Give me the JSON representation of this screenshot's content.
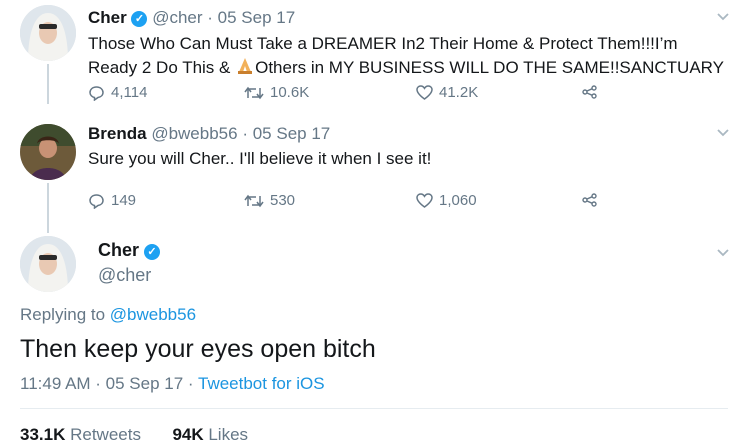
{
  "tweet1": {
    "name": "Cher",
    "handle": "@cher",
    "separator": "·",
    "date": "05 Sep 17",
    "line1": "Those Who Can Must Take a DREAMER In2 Their Home & Protect Them!!!I’m",
    "line2_a": "Ready 2 Do This & ",
    "line2_b": "Others in MY BUSINESS WILL DO THE SAME!!SANCTUARY",
    "replies": "4,114",
    "retweets": "10.6K",
    "likes": "41.2K"
  },
  "tweet2": {
    "name": "Brenda",
    "handle": "@bwebb56",
    "separator": "·",
    "date": "05 Sep 17",
    "text": "Sure you will Cher.. I'll believe it when I see it!",
    "replies": "149",
    "retweets": "530",
    "likes": "1,060"
  },
  "main_tweet": {
    "name": "Cher",
    "handle": "@cher",
    "replying_prefix": "Replying to ",
    "replying_to": "@bwebb56",
    "text": "Then keep your eyes open bitch",
    "time_date": "11:49 AM · 05 Sep 17 · ",
    "client": "Tweetbot for iOS",
    "retweets_count": "33.1K",
    "retweets_label": " Retweets",
    "likes_count": "94K",
    "likes_label": " Likes"
  },
  "colors": {
    "link": "#1b95e0",
    "verified": "#1da1f2",
    "muted": "#657786"
  }
}
